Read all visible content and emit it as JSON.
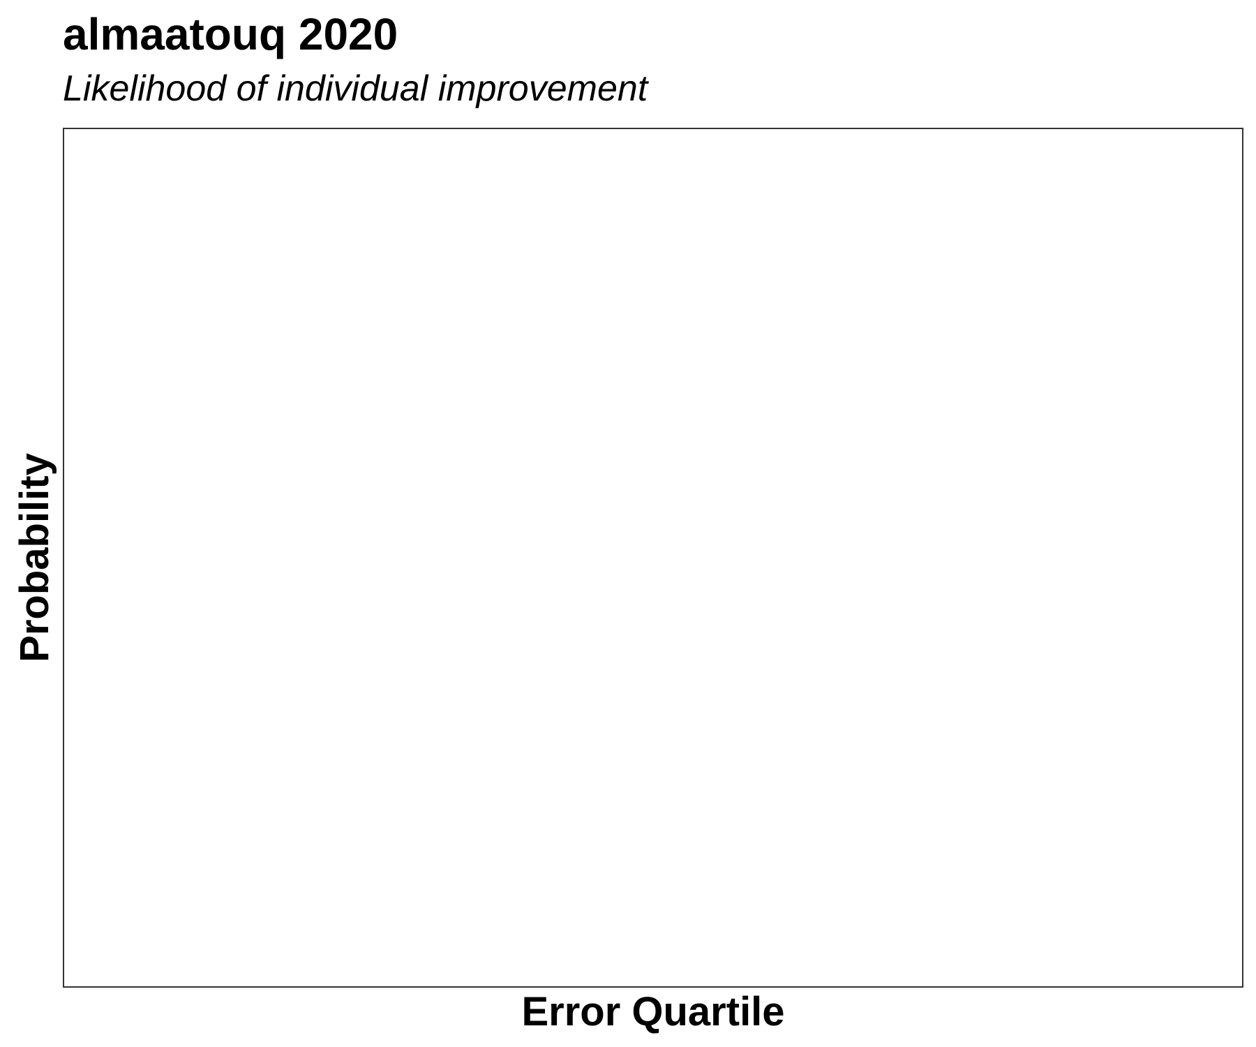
{
  "chart_data": {
    "type": "scatter",
    "title": "almaatouq 2020",
    "subtitle": "Likelihood of individual improvement",
    "xlabel": "Error Quartile",
    "ylabel": "Probability",
    "series": [],
    "grid": false
  }
}
